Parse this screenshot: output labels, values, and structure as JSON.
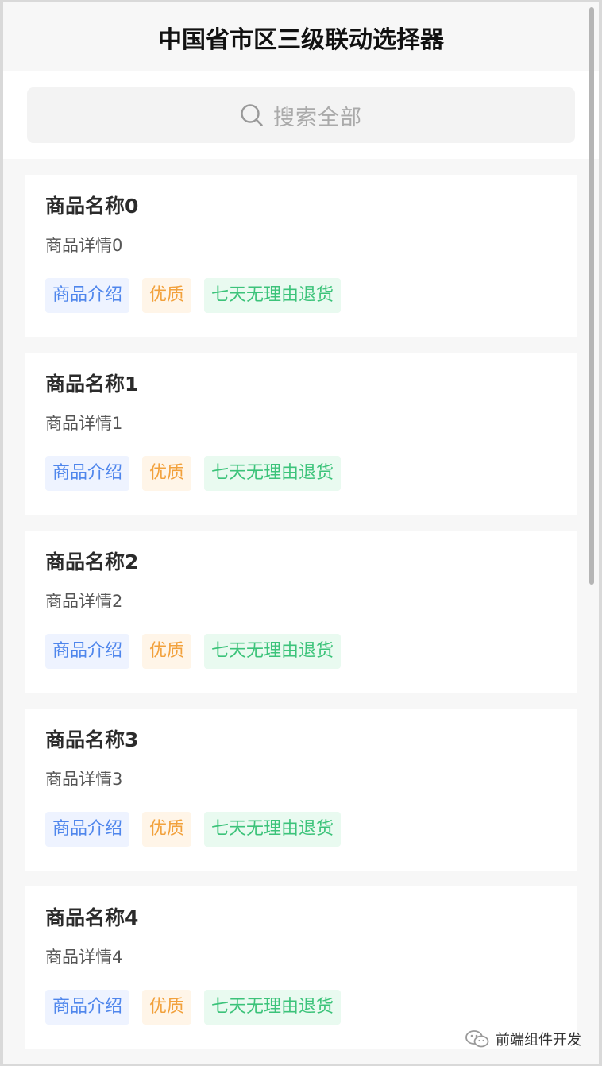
{
  "navbar": {
    "title": "中国省市区三级联动选择器"
  },
  "search": {
    "placeholder": "搜索全部",
    "icon": "search-icon"
  },
  "products": [
    {
      "title": "商品名称0",
      "desc": "商品详情0",
      "tags": [
        "商品介绍",
        "优质",
        "七天无理由退货"
      ]
    },
    {
      "title": "商品名称1",
      "desc": "商品详情1",
      "tags": [
        "商品介绍",
        "优质",
        "七天无理由退货"
      ]
    },
    {
      "title": "商品名称2",
      "desc": "商品详情2",
      "tags": [
        "商品介绍",
        "优质",
        "七天无理由退货"
      ]
    },
    {
      "title": "商品名称3",
      "desc": "商品详情3",
      "tags": [
        "商品介绍",
        "优质",
        "七天无理由退货"
      ]
    },
    {
      "title": "商品名称4",
      "desc": "商品详情4",
      "tags": [
        "商品介绍",
        "优质",
        "七天无理由退货"
      ]
    }
  ],
  "colors": {
    "tag_blue": "#4f86ec",
    "tag_orange": "#f2a13c",
    "tag_green": "#3cc37a"
  },
  "watermark": {
    "text": "前端组件开发",
    "icon": "wechat-icon"
  }
}
